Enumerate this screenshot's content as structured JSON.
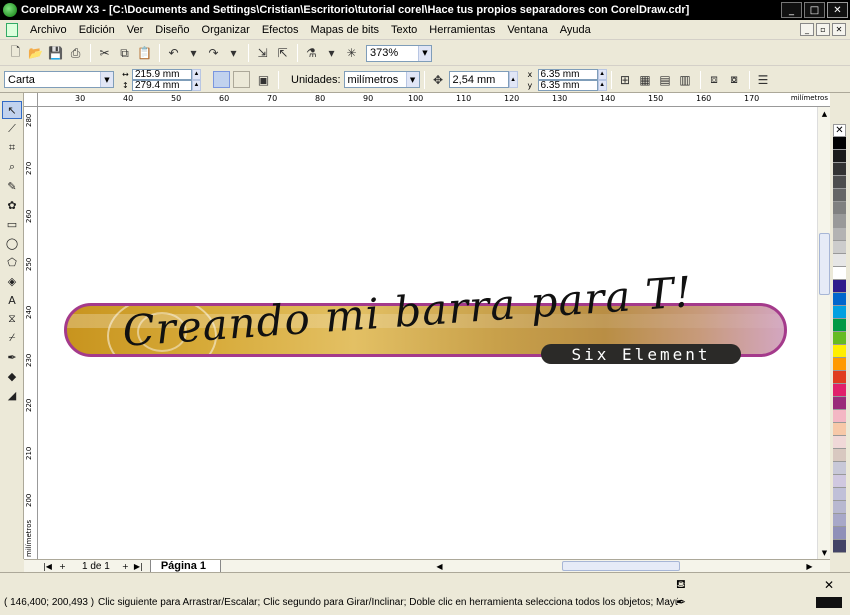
{
  "window": {
    "title": "CorelDRAW X3 - [C:\\Documents and Settings\\Cristian\\Escritorio\\tutorial corel\\Hace tus propios separadores con CorelDraw.cdr]",
    "minimize": "_",
    "maximize": "□",
    "close": "✕"
  },
  "menu": {
    "items": [
      "Archivo",
      "Edición",
      "Ver",
      "Diseño",
      "Organizar",
      "Efectos",
      "Mapas de bits",
      "Texto",
      "Herramientas",
      "Ventana",
      "Ayuda"
    ],
    "doc_minimize": "_",
    "doc_restore": "▫",
    "doc_close": "✕"
  },
  "toolbar": {
    "zoom": "373%"
  },
  "property_bar": {
    "paper": "Carta",
    "width": "215.9 mm",
    "height": "279.4 mm",
    "units_label": "Unidades:",
    "units": "milímetros",
    "nudge": "2,54 mm",
    "dup_x": "6.35 mm",
    "dup_y": "6.35 mm"
  },
  "ruler": {
    "top_ticks": [
      "30",
      "40",
      "50",
      "60",
      "70",
      "80",
      "90",
      "100",
      "110",
      "120",
      "130",
      "140",
      "150",
      "160",
      "170"
    ],
    "top_unit": "milímetros",
    "left_ticks": [
      "280",
      "270",
      "260",
      "250",
      "240",
      "230",
      "220",
      "210",
      "200"
    ],
    "left_unit": "milímetros"
  },
  "canvas": {
    "banner_title": "Creando mi barra para T!",
    "banner_subtitle": "Six Element"
  },
  "page_nav": {
    "count": "1 de 1",
    "tab": "Página 1"
  },
  "status": {
    "coords": "( 146,400; 200,493 )",
    "message": "Clic siguiente para Arrastrar/Escalar; Clic segundo para Girar/Inclinar; Doble clic en herramienta selecciona todos los objetos; Mayús+clic selec..."
  },
  "palette": {
    "colors": [
      "#000000",
      "#1a1a1a",
      "#333333",
      "#4d4d4d",
      "#666666",
      "#808080",
      "#999999",
      "#b3b3b3",
      "#cccccc",
      "#e6e6e6",
      "#ffffff",
      "#2e1a8c",
      "#0066cc",
      "#00a0e0",
      "#009944",
      "#66bb22",
      "#ffee00",
      "#ff9900",
      "#e03c1e",
      "#e0206a",
      "#9a2b7a",
      "#f4b7c4",
      "#f7c8a8",
      "#f0d8d8",
      "#d8c8c0",
      "#c8c8d8",
      "#d0c8e0",
      "#c0c0d8",
      "#b8b8d0",
      "#a8a8c8",
      "#9090b8",
      "#444466"
    ]
  },
  "colors": {
    "banner_border": "#a43a8b",
    "subtitle_bg": "#2b2a28"
  }
}
